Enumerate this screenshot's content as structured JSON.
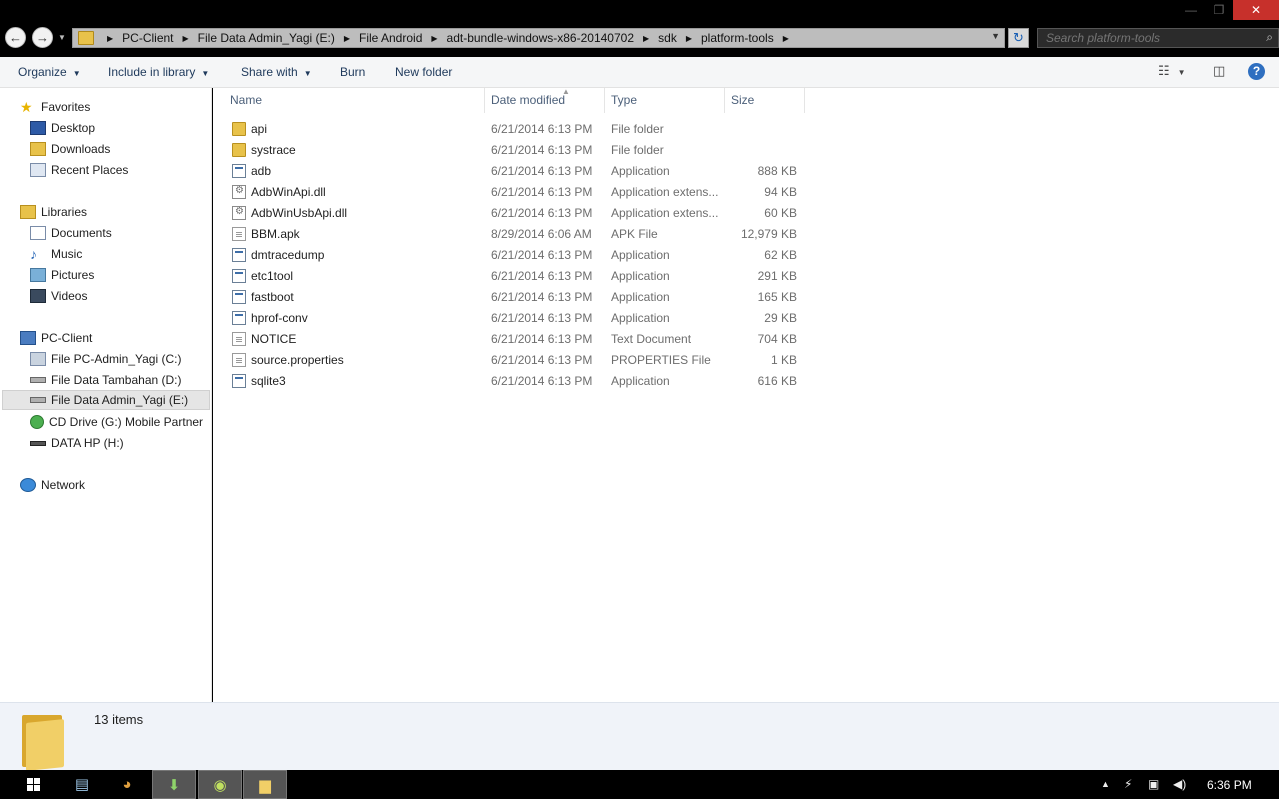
{
  "window": {
    "min_glyph": "—",
    "max_glyph": "❐",
    "close_glyph": "✕"
  },
  "address": {
    "crumbs": [
      "PC-Client",
      "File Data Admin_Yagi (E:)",
      "File Android",
      "adt-bundle-windows-x86-20140702",
      "sdk",
      "platform-tools"
    ]
  },
  "search": {
    "placeholder": "Search platform-tools"
  },
  "toolbar": {
    "organize": "Organize",
    "include_in_library": "Include in library",
    "share_with": "Share with",
    "burn": "Burn",
    "new_folder": "New folder"
  },
  "nav": {
    "favorites": "Favorites",
    "desktop": "Desktop",
    "downloads": "Downloads",
    "recent_places": "Recent Places",
    "libraries": "Libraries",
    "documents": "Documents",
    "music": "Music",
    "pictures": "Pictures",
    "videos": "Videos",
    "pc_client": "PC-Client",
    "drive_c": "File PC-Admin_Yagi (C:)",
    "drive_d": "File Data Tambahan (D:)",
    "drive_e": "File Data Admin_Yagi (E:)",
    "drive_g": "CD Drive (G:) Mobile Partner",
    "drive_h": "DATA HP (H:)",
    "network": "Network"
  },
  "columns": {
    "name": "Name",
    "date": "Date modified",
    "type": "Type",
    "size": "Size"
  },
  "files": [
    {
      "name": "api",
      "date": "6/21/2014 6:13 PM",
      "type": "File folder",
      "size": "",
      "icon": "folder"
    },
    {
      "name": "systrace",
      "date": "6/21/2014 6:13 PM",
      "type": "File folder",
      "size": "",
      "icon": "folder"
    },
    {
      "name": "adb",
      "date": "6/21/2014 6:13 PM",
      "type": "Application",
      "size": "888 KB",
      "icon": "app"
    },
    {
      "name": "AdbWinApi.dll",
      "date": "6/21/2014 6:13 PM",
      "type": "Application extens...",
      "size": "94 KB",
      "icon": "dll"
    },
    {
      "name": "AdbWinUsbApi.dll",
      "date": "6/21/2014 6:13 PM",
      "type": "Application extens...",
      "size": "60 KB",
      "icon": "dll"
    },
    {
      "name": "BBM.apk",
      "date": "8/29/2014 6:06 AM",
      "type": "APK File",
      "size": "12,979 KB",
      "icon": "doc"
    },
    {
      "name": "dmtracedump",
      "date": "6/21/2014 6:13 PM",
      "type": "Application",
      "size": "62 KB",
      "icon": "app"
    },
    {
      "name": "etc1tool",
      "date": "6/21/2014 6:13 PM",
      "type": "Application",
      "size": "291 KB",
      "icon": "app"
    },
    {
      "name": "fastboot",
      "date": "6/21/2014 6:13 PM",
      "type": "Application",
      "size": "165 KB",
      "icon": "app"
    },
    {
      "name": "hprof-conv",
      "date": "6/21/2014 6:13 PM",
      "type": "Application",
      "size": "29 KB",
      "icon": "app"
    },
    {
      "name": "NOTICE",
      "date": "6/21/2014 6:13 PM",
      "type": "Text Document",
      "size": "704 KB",
      "icon": "doc"
    },
    {
      "name": "source.properties",
      "date": "6/21/2014 6:13 PM",
      "type": "PROPERTIES File",
      "size": "1 KB",
      "icon": "doc"
    },
    {
      "name": "sqlite3",
      "date": "6/21/2014 6:13 PM",
      "type": "Application",
      "size": "616 KB",
      "icon": "app"
    }
  ],
  "status": {
    "item_count": "13 items"
  },
  "taskbar": {
    "clock": "6:36 PM"
  }
}
